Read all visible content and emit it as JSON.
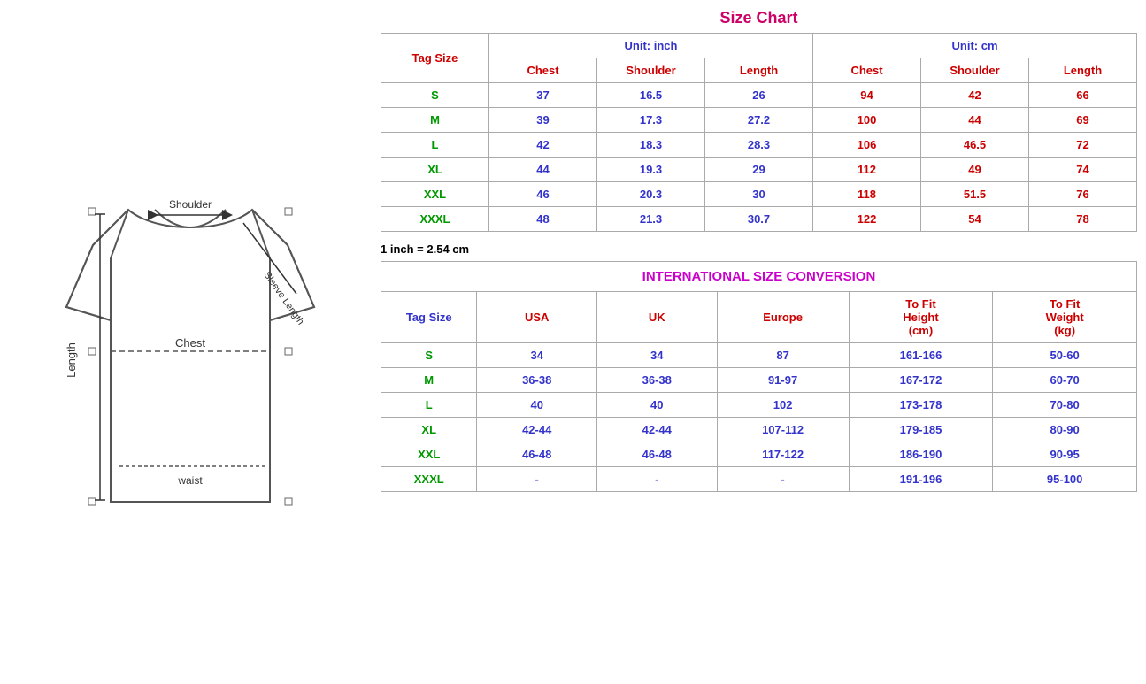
{
  "sizeChart": {
    "title": "Size Chart",
    "unitInch": "Unit: inch",
    "unitCm": "Unit: cm",
    "tagSizeLabel": "Tag Size",
    "inchHeaders": [
      "Chest",
      "Shoulder",
      "Length"
    ],
    "cmHeaders": [
      "Chest",
      "Shoulder",
      "Length"
    ],
    "rows": [
      {
        "tag": "S",
        "inch": [
          "37",
          "16.5",
          "26"
        ],
        "cm": [
          "94",
          "42",
          "66"
        ]
      },
      {
        "tag": "M",
        "inch": [
          "39",
          "17.3",
          "27.2"
        ],
        "cm": [
          "100",
          "44",
          "69"
        ]
      },
      {
        "tag": "L",
        "inch": [
          "42",
          "18.3",
          "28.3"
        ],
        "cm": [
          "106",
          "46.5",
          "72"
        ]
      },
      {
        "tag": "XL",
        "inch": [
          "44",
          "19.3",
          "29"
        ],
        "cm": [
          "112",
          "49",
          "74"
        ]
      },
      {
        "tag": "XXL",
        "inch": [
          "46",
          "20.3",
          "30"
        ],
        "cm": [
          "118",
          "51.5",
          "76"
        ]
      },
      {
        "tag": "XXXL",
        "inch": [
          "48",
          "21.3",
          "30.7"
        ],
        "cm": [
          "122",
          "54",
          "78"
        ]
      }
    ],
    "conversionNote": "1 inch = 2.54 cm"
  },
  "intlConversion": {
    "title": "INTERNATIONAL SIZE CONVERSION",
    "tagSizeLabel": "Tag Size",
    "headers": [
      "USA",
      "UK",
      "Europe",
      "To Fit\nHeight\n(cm)",
      "To Fit\nWeight\n(kg)"
    ],
    "header_usa": "USA",
    "header_uk": "UK",
    "header_europe": "Europe",
    "header_height": "To Fit Height (cm)",
    "header_weight": "To Fit Weight (kg)",
    "rows": [
      {
        "tag": "S",
        "usa": "34",
        "uk": "34",
        "europe": "87",
        "height": "161-166",
        "weight": "50-60"
      },
      {
        "tag": "M",
        "usa": "36-38",
        "uk": "36-38",
        "europe": "91-97",
        "height": "167-172",
        "weight": "60-70"
      },
      {
        "tag": "L",
        "usa": "40",
        "uk": "40",
        "europe": "102",
        "height": "173-178",
        "weight": "70-80"
      },
      {
        "tag": "XL",
        "usa": "42-44",
        "uk": "42-44",
        "europe": "107-112",
        "height": "179-185",
        "weight": "80-90"
      },
      {
        "tag": "XXL",
        "usa": "46-48",
        "uk": "46-48",
        "europe": "117-122",
        "height": "186-190",
        "weight": "90-95"
      },
      {
        "tag": "XXXL",
        "usa": "-",
        "uk": "-",
        "europe": "-",
        "height": "191-196",
        "weight": "95-100"
      }
    ]
  },
  "diagram": {
    "labels": {
      "shoulder": "Shoulder",
      "sleeveLength": "Sleeve Length",
      "chest": "Chest",
      "length": "Length",
      "waist": "waist"
    }
  }
}
